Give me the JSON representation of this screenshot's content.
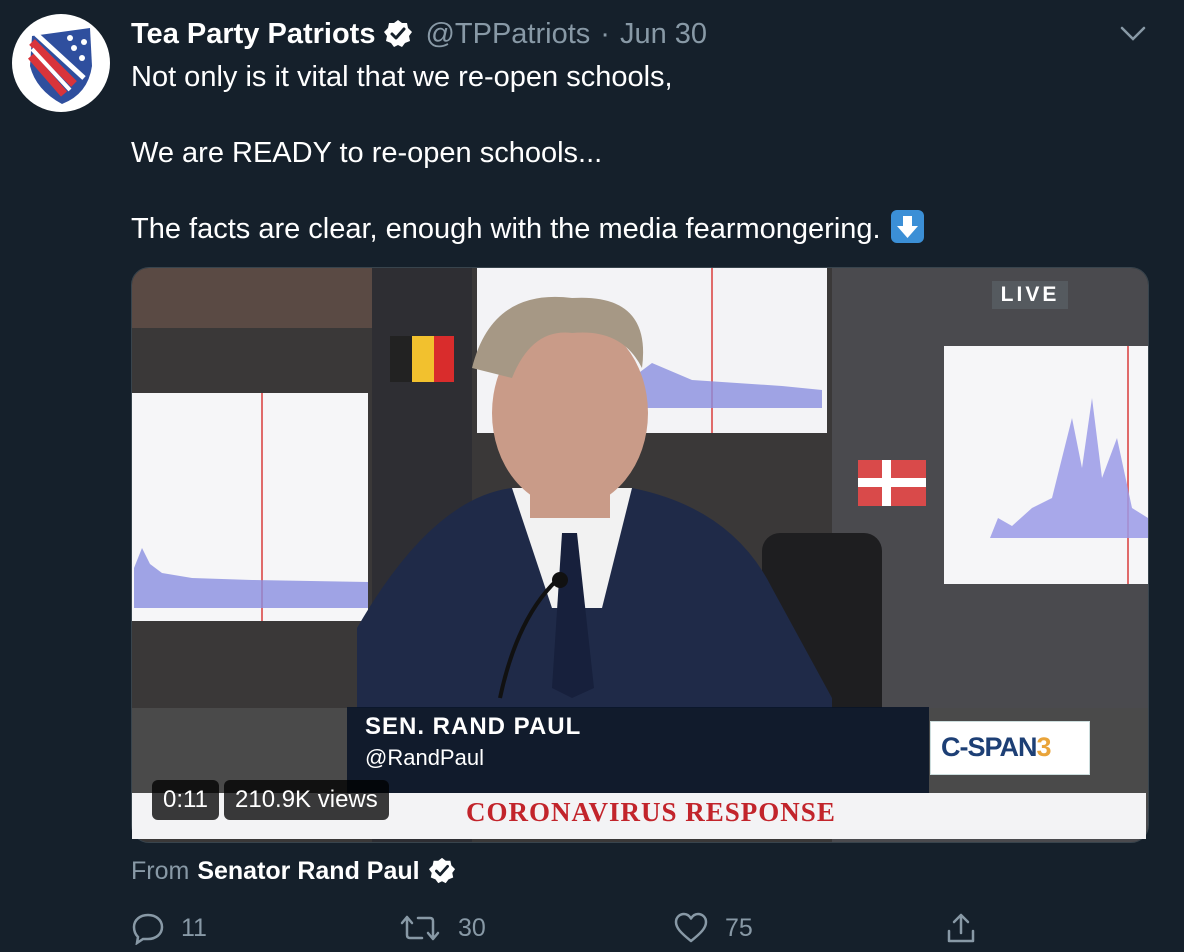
{
  "tweet": {
    "author_name": "Tea Party Patriots",
    "handle": "@TPPatriots",
    "separator": "·",
    "date": "Jun 30",
    "text_lines": [
      "Not only is it vital that we re-open schools,",
      "We are READY to re-open schools...",
      "The facts are clear, enough with the media fearmongering."
    ]
  },
  "media": {
    "live_badge": "LIVE",
    "lower_third_name": "SEN. RAND PAUL",
    "lower_third_handle": "@RandPaul",
    "network_logo": "C-SPAN3",
    "ticker": "CORONAVIRUS RESPONSE",
    "duration": "0:11",
    "views": "210.9K views"
  },
  "attribution": {
    "prefix": "From",
    "source": "Senator Rand Paul"
  },
  "actions": {
    "reply_count": "11",
    "retweet_count": "30",
    "like_count": "75"
  },
  "icons": {
    "verified": "verified-badge-icon",
    "caret": "chevron-down-icon",
    "reply": "reply-icon",
    "retweet": "retweet-icon",
    "like": "heart-icon",
    "share": "share-icon"
  },
  "colors": {
    "background": "#15202b",
    "secondary_text": "#8899a6",
    "cspan_blue": "#1d3f75",
    "cspan_orange": "#e9a43a",
    "ticker_red": "#c2242b"
  }
}
